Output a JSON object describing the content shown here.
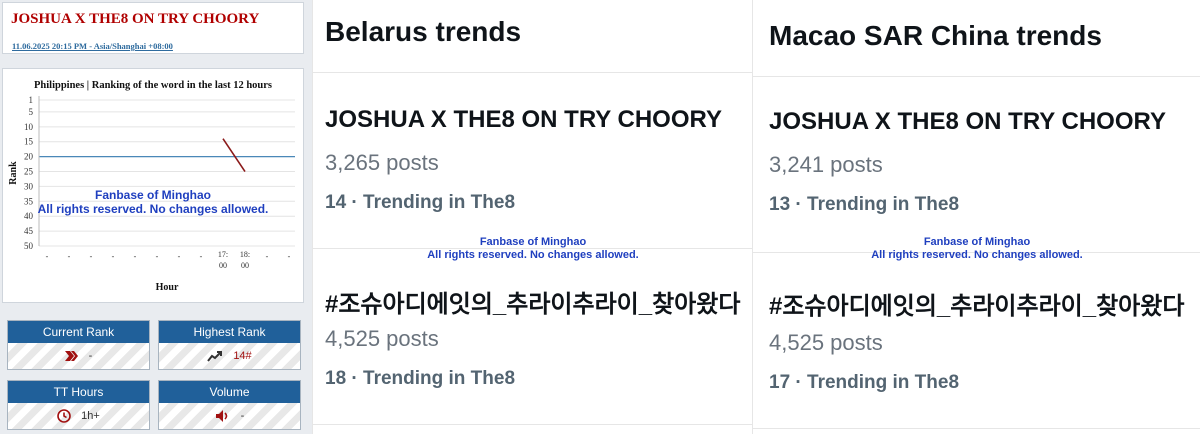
{
  "left": {
    "title": "JOSHUA X THE8 ON TRY CHOORY",
    "date": "11.06.2025 20:15 PM - Asia/Shanghai +08:00",
    "chart_title": "Philippines | Ranking of the word in the last 12 hours",
    "watermark_line1": "Fanbase of Minghao",
    "watermark_line2": "All rights reserved. No changes allowed.",
    "stats": [
      {
        "label": "Current Rank",
        "value": "-",
        "icon": "chevron-right-icon"
      },
      {
        "label": "Highest Rank",
        "value": "14#",
        "icon": "trending-up-icon"
      },
      {
        "label": "TT Hours",
        "value": "1h+",
        "icon": "clock-icon"
      },
      {
        "label": "Volume",
        "value": "-",
        "icon": "speaker-icon"
      }
    ]
  },
  "chart_data": {
    "type": "line",
    "title": "Philippines | Ranking of the word in the last 12 hours",
    "xlabel": "Hour",
    "ylabel": "Rank",
    "categories": [
      "-",
      "-",
      "-",
      "-",
      "-",
      "-",
      "-",
      "-",
      "17:00",
      "18:00",
      "-",
      "-"
    ],
    "yticks": [
      1,
      5,
      10,
      15,
      20,
      25,
      30,
      35,
      40,
      45,
      50
    ],
    "ylim": [
      1,
      50
    ],
    "y_inverted": true,
    "reference_line": 20,
    "series": [
      {
        "values": [
          null,
          null,
          null,
          null,
          null,
          null,
          null,
          null,
          14,
          25,
          null,
          null
        ]
      }
    ],
    "colors": {
      "series": "#8b1a1a",
      "reference": "#4a88b8"
    }
  },
  "belarus": {
    "heading": "Belarus trends",
    "items": [
      {
        "name": "JOSHUA X THE8 ON TRY CHOORY",
        "posts": "3,265 posts",
        "meta": "14 · Trending in The8"
      },
      {
        "name": "#조슈아디에잇의_추라이추라이_찾아왔다",
        "posts": "4,525 posts",
        "meta": "18 · Trending in The8"
      }
    ],
    "watermark_line1": "Fanbase of Minghao",
    "watermark_line2": "All rights reserved. No changes allowed."
  },
  "macao": {
    "heading": "Macao SAR China trends",
    "items": [
      {
        "name": "JOSHUA X THE8 ON TRY CHOORY",
        "posts": "3,241 posts",
        "meta": "13 · Trending in The8"
      },
      {
        "name": "#조슈아디에잇의_추라이추라이_찾아왔다",
        "posts": "4,525 posts",
        "meta": "17 · Trending in The8"
      }
    ],
    "watermark_line1": "Fanbase of Minghao",
    "watermark_line2": "All rights reserved. No changes allowed."
  }
}
